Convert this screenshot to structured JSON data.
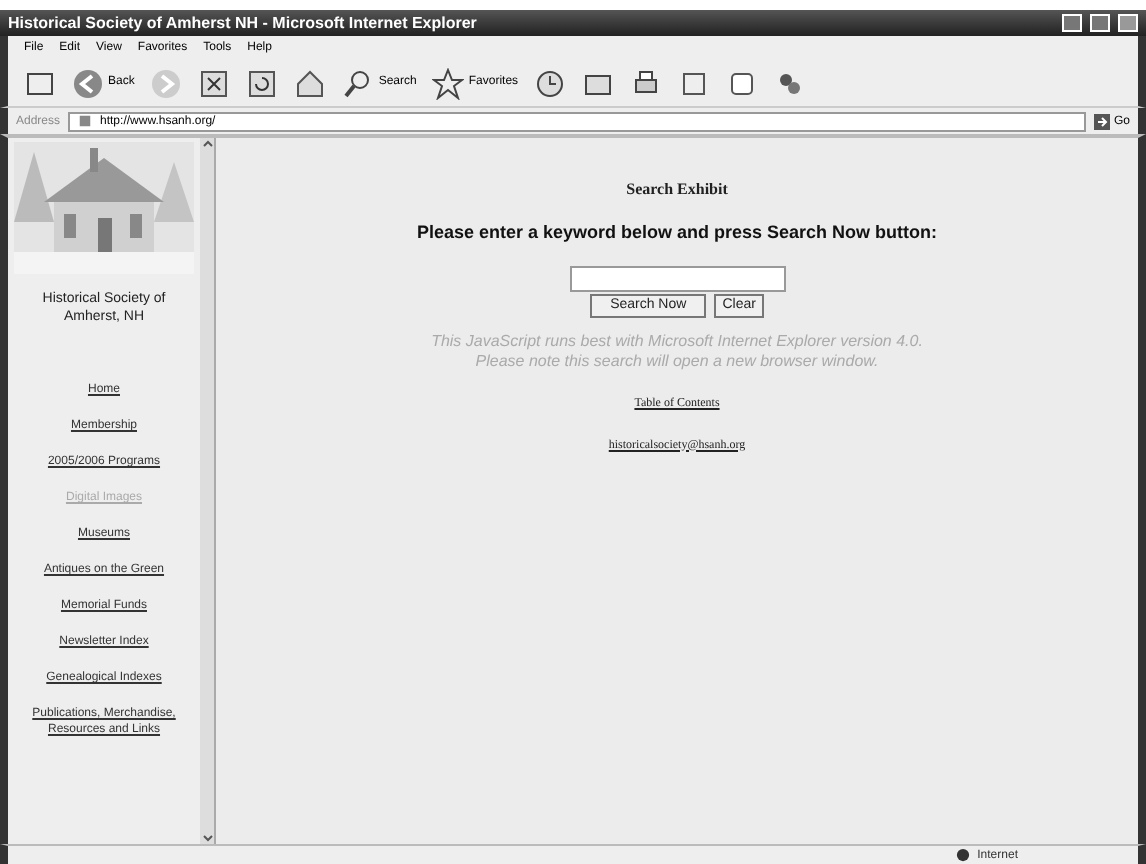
{
  "window": {
    "title": "Historical Society of Amherst NH - Microsoft Internet Explorer"
  },
  "menu": [
    "File",
    "Edit",
    "View",
    "Favorites",
    "Tools",
    "Help"
  ],
  "toolbar": {
    "back": "Back",
    "search": "Search",
    "favorites": "Favorites"
  },
  "address": {
    "label": "Address",
    "url": "http://www.hsanh.org/",
    "go": "Go"
  },
  "sidebar": {
    "caption": "Historical Society of Amherst, NH",
    "items": [
      {
        "label": "Home",
        "dimmed": false
      },
      {
        "label": "Membership",
        "dimmed": false
      },
      {
        "label": "2005/2006 Programs",
        "dimmed": false
      },
      {
        "label": "Digital Images",
        "dimmed": true
      },
      {
        "label": "Museums",
        "dimmed": false
      },
      {
        "label": "Antiques on the Green",
        "dimmed": false
      },
      {
        "label": "Memorial Funds",
        "dimmed": false
      },
      {
        "label": "Newsletter Index",
        "dimmed": false
      },
      {
        "label": "Genealogical Indexes",
        "dimmed": false
      },
      {
        "label": "Publications, Merchandise, Resources and Links",
        "dimmed": false
      }
    ]
  },
  "main": {
    "heading": "Search Exhibit",
    "instruction": "Please enter a keyword below and press Search Now button:",
    "search_button": "Search Now",
    "clear_button": "Clear",
    "notes": [
      "This JavaScript runs best with Microsoft Internet Explorer version 4.0.",
      "Please note this search will open a new browser window."
    ],
    "links": [
      "Table of Contents",
      "historicalsociety@hsanh.org"
    ]
  },
  "status_bar": {
    "zone": "Internet"
  }
}
